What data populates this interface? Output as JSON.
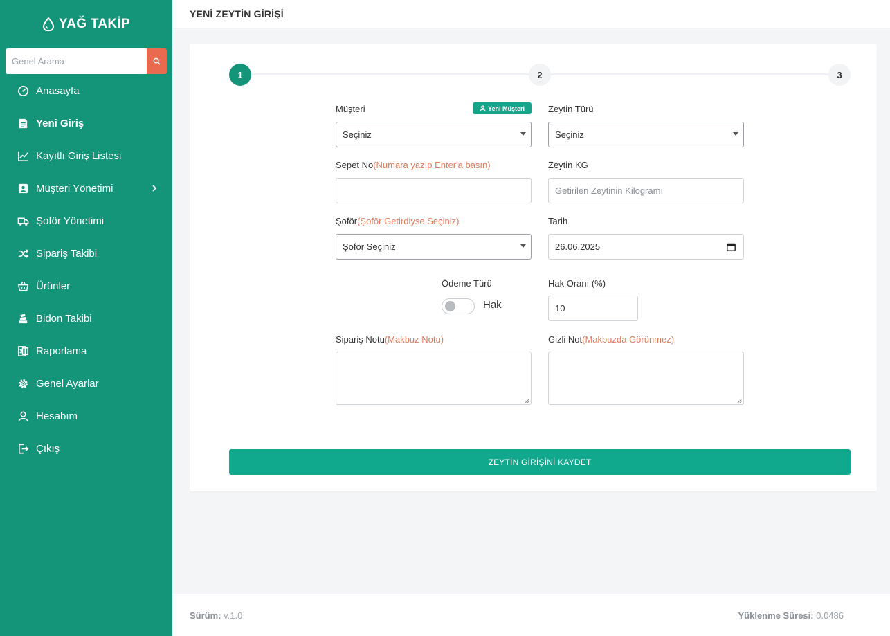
{
  "brand": {
    "name": "YAĞ TAKİP",
    "icon": "oil-drop-icon"
  },
  "search": {
    "placeholder": "Genel Arama",
    "icon": "search-icon"
  },
  "sidebar": {
    "items": [
      {
        "label": "Anasayfa",
        "icon": "dashboard-icon"
      },
      {
        "label": "Yeni Giriş",
        "icon": "document-icon",
        "active": true
      },
      {
        "label": "Kayıtlı Giriş Listesi",
        "icon": "chart-line-icon"
      },
      {
        "label": "Müşteri Yönetimi",
        "icon": "contact-card-icon",
        "has_submenu": true
      },
      {
        "label": "Şoför Yönetimi",
        "icon": "truck-icon"
      },
      {
        "label": "Sipariş Takibi",
        "icon": "shuffle-icon"
      },
      {
        "label": "Ürünler",
        "icon": "basket-icon"
      },
      {
        "label": "Bidon Takibi",
        "icon": "stack-icon"
      },
      {
        "label": "Raporlama",
        "icon": "excel-icon"
      },
      {
        "label": "Genel Ayarlar",
        "icon": "gear-icon"
      },
      {
        "label": "Hesabım",
        "icon": "user-icon"
      },
      {
        "label": "Çıkış",
        "icon": "logout-icon"
      }
    ]
  },
  "header": {
    "title": "YENİ ZEYTİN GİRİŞİ"
  },
  "stepper": {
    "steps": [
      "1",
      "2",
      "3"
    ],
    "active": 1
  },
  "form": {
    "musteri": {
      "label": "Müşteri",
      "value": "Seçiniz",
      "new_button": "Yeni Müşteri"
    },
    "zeytin_turu": {
      "label": "Zeytin Türü",
      "value": "Seçiniz"
    },
    "sepet_no": {
      "label": "Sepet No",
      "hint": "(Numara yazıp Enter'a basın)",
      "value": ""
    },
    "zeytin_kg": {
      "label": "Zeytin KG",
      "placeholder": "Getirilen Zeytinin Kilogramı"
    },
    "sofor": {
      "label": "Şoför",
      "hint": "(Şoför Getirdiyse Seçiniz)",
      "value": "Şoför Seçiniz"
    },
    "tarih": {
      "label": "Tarih",
      "value": "26.06.2025"
    },
    "odeme_turu": {
      "label": "Ödeme Türü",
      "toggle_label": "Hak"
    },
    "hak_orani": {
      "label": "Hak Oranı (%)",
      "value": "10"
    },
    "siparis_notu": {
      "label": "Sipariş Notu",
      "hint": "(Makbuz Notu)"
    },
    "gizli_not": {
      "label": "Gizli Not",
      "hint": "(Makbuzda Görünmez)"
    },
    "save_label": "ZEYTİN GİRİŞİNİ KAYDET"
  },
  "footer": {
    "version_label": "Sürüm:",
    "version": "v.1.0",
    "load_label": "Yüklenme Süresi:",
    "load_time": "0.0486"
  },
  "colors": {
    "sidebar": "#149479",
    "accent": "#11a98e",
    "search_button": "#e96a4f",
    "hint": "#e07b5a"
  }
}
